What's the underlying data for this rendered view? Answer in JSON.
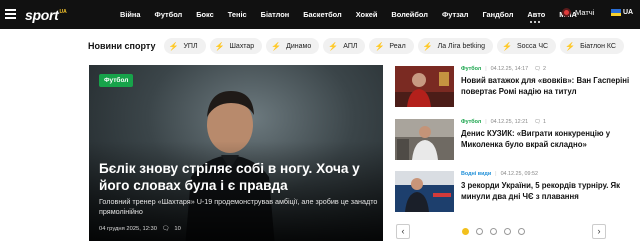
{
  "header": {
    "logo_text": "sport",
    "logo_suffix": "UA",
    "nav_items": [
      "Війна",
      "Футбол",
      "Бокс",
      "Теніс",
      "Біатлон",
      "Баскетбол",
      "Хокей",
      "Волейбол",
      "Футзал",
      "Гандбол",
      "Авто",
      "MMA"
    ],
    "matches_label": "Матчі",
    "language": "UA"
  },
  "tags": {
    "title": "Новини спорту",
    "items": [
      "УПЛ",
      "Шахтар",
      "Динамо",
      "АПЛ",
      "Реал",
      "Ла Ліга betking",
      "Socca ЧС",
      "Біатлон КС"
    ]
  },
  "hero": {
    "category": "Футбол",
    "title": "Бєлік знову стріляє собі в ногу. Хоча у його словах була і є правда",
    "lead": "Головний тренер «Шахтаря» U-19 продемонстрував амбіції, але зробив це занадто прямолінійно",
    "date": "04 грудня 2025, 12:30",
    "comments": "10"
  },
  "news": [
    {
      "category": "Футбол",
      "date": "04.12.25, 14:17",
      "comments": "2",
      "title": "Новий ватажок для «вовків»: Ван Гасперіні повертає Ромі надію на титул"
    },
    {
      "category": "Футбол",
      "date": "04.12.25, 12:21",
      "comments": "1",
      "title": "Денис КУЗИК: «Виграти конкуренцію у Миколенка було вкрай складно»"
    },
    {
      "category": "Водні види",
      "date": "04.12.25, 09:52",
      "comments": "",
      "title": "3 рекорди України, 5 рекордів турніру. Як минули два дні ЧЄ з плавання"
    }
  ],
  "carousel": {
    "prev_icon": "chevron-left-icon",
    "next_icon": "chevron-right-icon",
    "pages": 5,
    "active_page": 1
  },
  "colors": {
    "accent": "#f2c01d",
    "category_green": "#17a34a",
    "category_blue": "#1e8fd8",
    "topbar": "#111111"
  }
}
